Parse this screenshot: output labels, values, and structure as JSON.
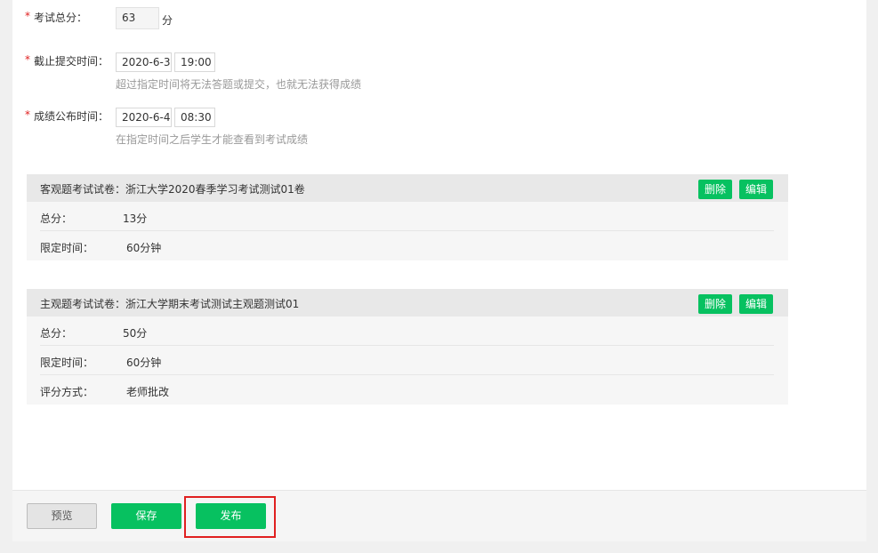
{
  "form": {
    "total_score": {
      "label": "考试总分：",
      "value": "63",
      "unit": "分"
    },
    "deadline": {
      "label": "截止提交时间：",
      "date": "2020-6-3",
      "time": "19:00",
      "hint": "超过指定时间将无法答题或提交，也就无法获得成绩"
    },
    "publish_time": {
      "label": "成绩公布时间：",
      "date": "2020-6-4",
      "time": "08:30",
      "hint": "在指定时间之后学生才能查看到考试成绩"
    },
    "required_mark": "*"
  },
  "objective_paper": {
    "title": "客观题考试试卷：浙江大学2020春季学习考试测试01卷",
    "delete_label": "删除",
    "edit_label": "编辑",
    "rows": [
      {
        "key": "总分：",
        "value": "13分"
      },
      {
        "key": "限定时间：",
        "value": "60分钟"
      }
    ]
  },
  "subjective_paper": {
    "title": "主观题考试试卷：浙江大学期末考试测试主观题测试01",
    "delete_label": "删除",
    "edit_label": "编辑",
    "rows": [
      {
        "key": "总分：",
        "value": "50分"
      },
      {
        "key": "限定时间：",
        "value": "60分钟"
      },
      {
        "key": "评分方式：",
        "value": "老师批改"
      }
    ]
  },
  "footer": {
    "preview_label": "预览",
    "save_label": "保存",
    "publish_label": "发布"
  },
  "colors": {
    "accent": "#07c160",
    "required": "#e02020",
    "highlight": "#e02020"
  }
}
